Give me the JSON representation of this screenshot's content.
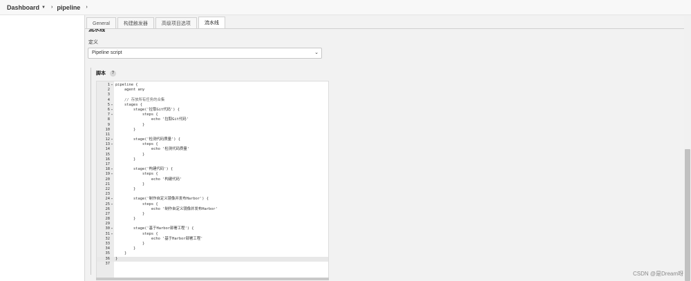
{
  "breadcrumb": {
    "items": [
      {
        "label": "Dashboard",
        "has_caret": true
      },
      {
        "label": "pipeline",
        "has_caret": false
      }
    ],
    "separator": "›"
  },
  "tabs": [
    {
      "label": "General",
      "active": false
    },
    {
      "label": "构建触发器",
      "active": false
    },
    {
      "label": "高级项目选项",
      "active": false
    },
    {
      "label": "流水线",
      "active": true
    }
  ],
  "section": {
    "title": "流水线"
  },
  "definition": {
    "label": "定义",
    "selected": "Pipeline script",
    "chevron": "⌄"
  },
  "script": {
    "label": "脚本",
    "help": "?"
  },
  "editor": {
    "current_line": 36,
    "lines": [
      {
        "n": "1",
        "fold": "▾",
        "code": "pipeline {"
      },
      {
        "n": "2",
        "fold": "",
        "code": "    agent any"
      },
      {
        "n": "3",
        "fold": "",
        "code": ""
      },
      {
        "n": "4",
        "fold": "",
        "code": "    // 存放所有任务的合集"
      },
      {
        "n": "5",
        "fold": "▾",
        "code": "    stages {"
      },
      {
        "n": "6",
        "fold": "▾",
        "code": "        stage('拉取Git代码') {"
      },
      {
        "n": "7",
        "fold": "▾",
        "code": "            steps {"
      },
      {
        "n": "8",
        "fold": "",
        "code": "                echo '拉取Git代码'"
      },
      {
        "n": "9",
        "fold": "",
        "code": "            }"
      },
      {
        "n": "10",
        "fold": "",
        "code": "        }"
      },
      {
        "n": "11",
        "fold": "",
        "code": ""
      },
      {
        "n": "12",
        "fold": "▾",
        "code": "        stage('检测代码质量') {"
      },
      {
        "n": "13",
        "fold": "▾",
        "code": "            steps {"
      },
      {
        "n": "14",
        "fold": "",
        "code": "                echo '检测代码质量'"
      },
      {
        "n": "15",
        "fold": "",
        "code": "            }"
      },
      {
        "n": "16",
        "fold": "",
        "code": "        }"
      },
      {
        "n": "17",
        "fold": "",
        "code": ""
      },
      {
        "n": "18",
        "fold": "▾",
        "code": "        stage('构建代码') {"
      },
      {
        "n": "19",
        "fold": "▾",
        "code": "            steps {"
      },
      {
        "n": "20",
        "fold": "",
        "code": "                echo '构建代码'"
      },
      {
        "n": "21",
        "fold": "",
        "code": "            }"
      },
      {
        "n": "22",
        "fold": "",
        "code": "        }"
      },
      {
        "n": "23",
        "fold": "",
        "code": ""
      },
      {
        "n": "24",
        "fold": "▾",
        "code": "        stage('制作自定义镜像并发布Harbor') {"
      },
      {
        "n": "25",
        "fold": "▾",
        "code": "            steps {"
      },
      {
        "n": "26",
        "fold": "",
        "code": "                echo '制作自定义镜像并发布Harbor'"
      },
      {
        "n": "27",
        "fold": "",
        "code": "            }"
      },
      {
        "n": "28",
        "fold": "",
        "code": "        }"
      },
      {
        "n": "29",
        "fold": "",
        "code": ""
      },
      {
        "n": "30",
        "fold": "▾",
        "code": "        stage('基于Harbor部署工程') {"
      },
      {
        "n": "31",
        "fold": "▾",
        "code": "            steps {"
      },
      {
        "n": "32",
        "fold": "",
        "code": "                echo '基于Harbor部署工程'"
      },
      {
        "n": "33",
        "fold": "",
        "code": "            }"
      },
      {
        "n": "34",
        "fold": "",
        "code": "        }"
      },
      {
        "n": "35",
        "fold": "",
        "code": "    }"
      },
      {
        "n": "36",
        "fold": "",
        "code": "}"
      },
      {
        "n": "37",
        "fold": "",
        "code": ""
      }
    ]
  },
  "watermark": "CSDN @是Dream呀"
}
